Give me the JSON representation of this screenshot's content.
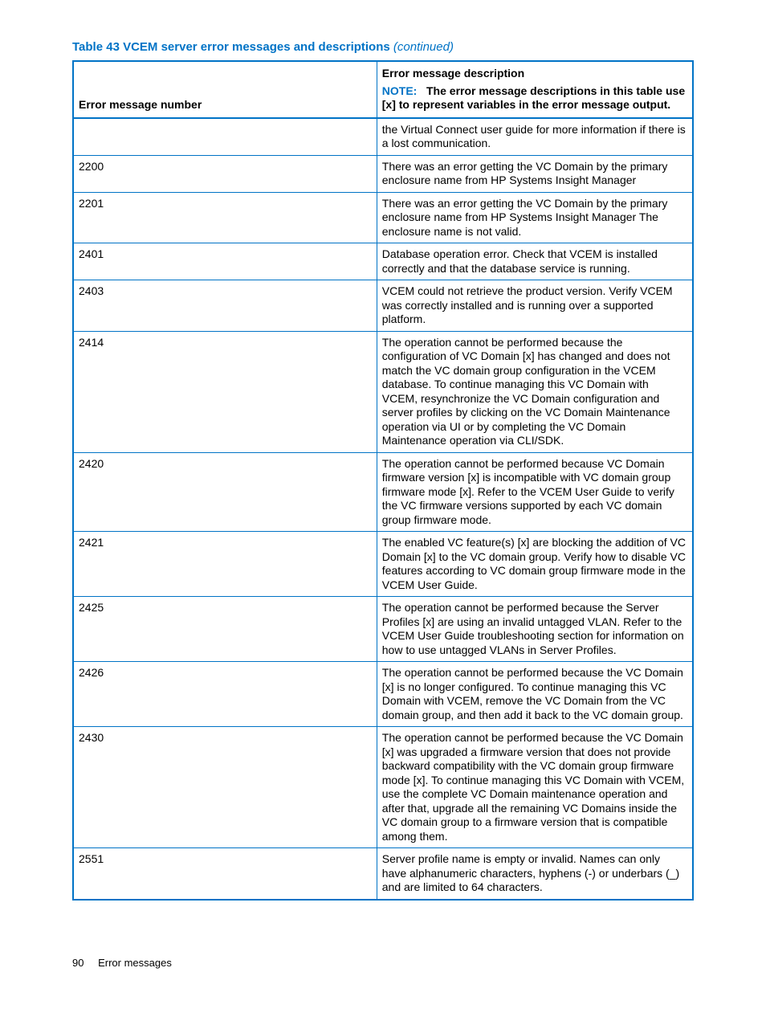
{
  "caption": {
    "prefix": "Table 43 VCEM server error messages and descriptions",
    "continued": "(continued)"
  },
  "header": {
    "col1": "Error message number",
    "col2_title": "Error message description",
    "col2_note_label": "NOTE:",
    "col2_note_text": "The error message descriptions in this table use [x] to represent variables in the error message output."
  },
  "rows": [
    {
      "num": "",
      "desc": "the Virtual Connect user guide for more information if there is a lost communication."
    },
    {
      "num": "2200",
      "desc": "There was an error getting the VC Domain by the primary enclosure name from HP Systems Insight Manager"
    },
    {
      "num": "2201",
      "desc": "There was an error getting the VC Domain by the primary enclosure name from HP Systems Insight Manager The enclosure name is not valid."
    },
    {
      "num": "2401",
      "desc": "Database operation error. Check that VCEM is installed correctly and that the database service is running."
    },
    {
      "num": "2403",
      "desc": "VCEM could not retrieve the product version. Verify VCEM was correctly installed and is running over a supported platform."
    },
    {
      "num": "2414",
      "desc": "The operation cannot be performed because the configuration of VC Domain [x] has changed and does not match the VC domain group configuration in the VCEM database. To continue managing this VC Domain with VCEM, resynchronize the VC Domain configuration and server profiles by clicking on the VC Domain Maintenance operation via UI or by completing the VC Domain Maintenance operation via CLI/SDK."
    },
    {
      "num": "2420",
      "desc": "The operation cannot be performed because VC Domain firmware version [x] is incompatible with VC domain group firmware mode [x]. Refer to the VCEM User Guide to verify the VC firmware versions supported by each VC domain group firmware mode."
    },
    {
      "num": "2421",
      "desc": "The enabled VC feature(s) [x] are blocking the addition of VC Domain [x] to the VC domain group. Verify how to disable VC features according to VC domain group firmware mode in the VCEM User Guide."
    },
    {
      "num": "2425",
      "desc": "The operation cannot be performed because the Server Profiles [x] are using an invalid untagged VLAN. Refer to the VCEM User Guide troubleshooting section for information on how to use untagged VLANs in Server Profiles."
    },
    {
      "num": "2426",
      "desc": "The operation cannot be performed because the VC Domain [x] is no longer configured. To continue managing this VC Domain with VCEM, remove the VC Domain from the VC domain group, and then add it back to the VC domain group."
    },
    {
      "num": "2430",
      "desc": "The operation cannot be performed because the VC Domain [x] was upgraded a firmware version that does not provide backward compatibility with the VC domain group firmware mode [x]. To continue managing this VC Domain with VCEM, use the complete VC Domain maintenance operation and after that, upgrade all the remaining VC Domains inside the VC domain group to a firmware version that is compatible among them."
    },
    {
      "num": "2551",
      "desc": "Server profile name is empty or invalid. Names can only have alphanumeric characters, hyphens (-) or underbars (_) and are limited to 64 characters."
    }
  ],
  "footer": {
    "page": "90",
    "section": "Error messages"
  }
}
